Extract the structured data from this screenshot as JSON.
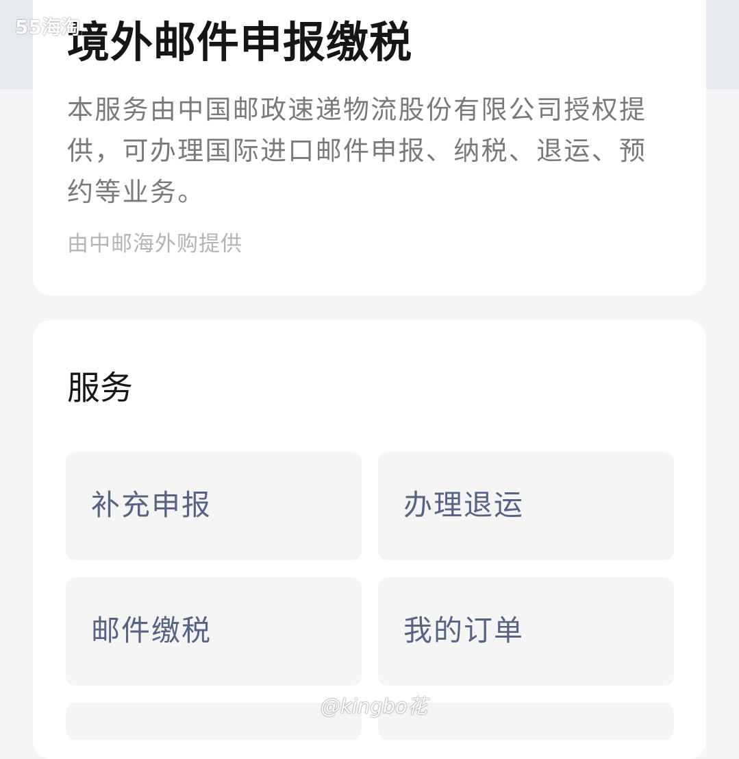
{
  "header": {
    "title": "境外邮件申报缴税",
    "description": "本服务由中国邮政速递物流股份有限公司授权提供，可办理国际进口邮件申报、纳税、退运、预约等业务。",
    "provider": "由中邮海外购提供"
  },
  "services": {
    "section_title": "服务",
    "items": [
      {
        "label": "补充申报"
      },
      {
        "label": "办理退运"
      },
      {
        "label": "邮件缴税"
      },
      {
        "label": "我的订单"
      },
      {
        "label": ""
      },
      {
        "label": ""
      }
    ]
  },
  "watermarks": {
    "top_left": "55海淘",
    "bottom": "@kingbo花"
  },
  "colors": {
    "page_background": "#f5f5f7",
    "header_background": "#e6e9f2",
    "card_background": "#ffffff",
    "tile_background": "#f5f5f6",
    "tile_label": "#556486",
    "title_text": "#161616",
    "description_text": "#7a7a7a",
    "provider_text": "#b4b4b4"
  }
}
